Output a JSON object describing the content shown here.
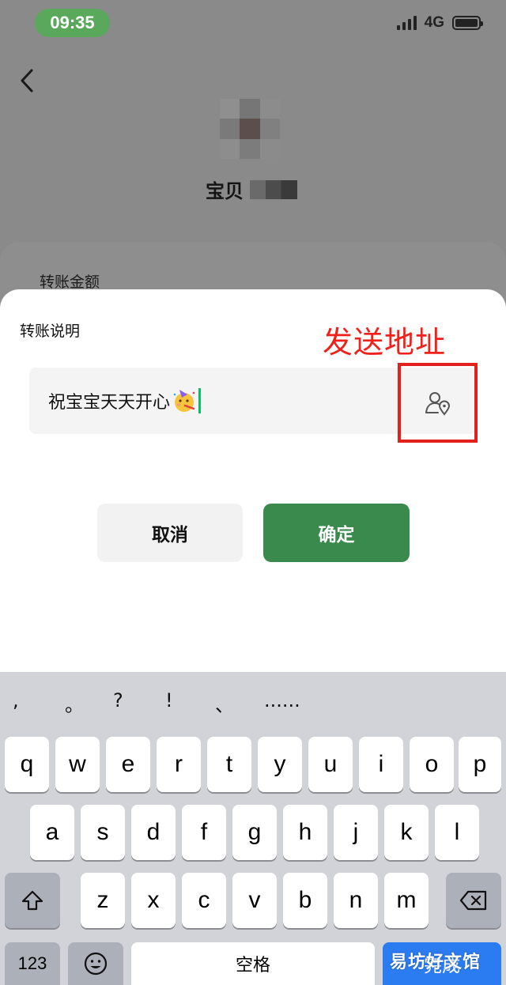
{
  "status_bar": {
    "time": "09:35",
    "network": "4G"
  },
  "background": {
    "payee_name": "宝贝",
    "amount_label": "转账金额"
  },
  "sheet": {
    "title": "转账说明",
    "annotation": "发送地址",
    "note_value": "祝宝宝天天开心",
    "cancel_label": "取消",
    "confirm_label": "确定"
  },
  "keyboard": {
    "punctuation": [
      ",",
      "。",
      "?",
      "!",
      "、",
      "......"
    ],
    "row1": [
      "q",
      "w",
      "e",
      "r",
      "t",
      "y",
      "u",
      "i",
      "o",
      "p"
    ],
    "row2": [
      "a",
      "s",
      "d",
      "f",
      "g",
      "h",
      "j",
      "k",
      "l"
    ],
    "row3": [
      "z",
      "x",
      "c",
      "v",
      "b",
      "n",
      "m"
    ],
    "numbers_label": "123",
    "space_label": "空格",
    "done_label": "完成"
  },
  "watermark": "易坊好文馆",
  "colors": {
    "accent_green": "#3a8a4d",
    "annotation_red": "#e3201c",
    "done_blue": "#2a7cf0"
  }
}
